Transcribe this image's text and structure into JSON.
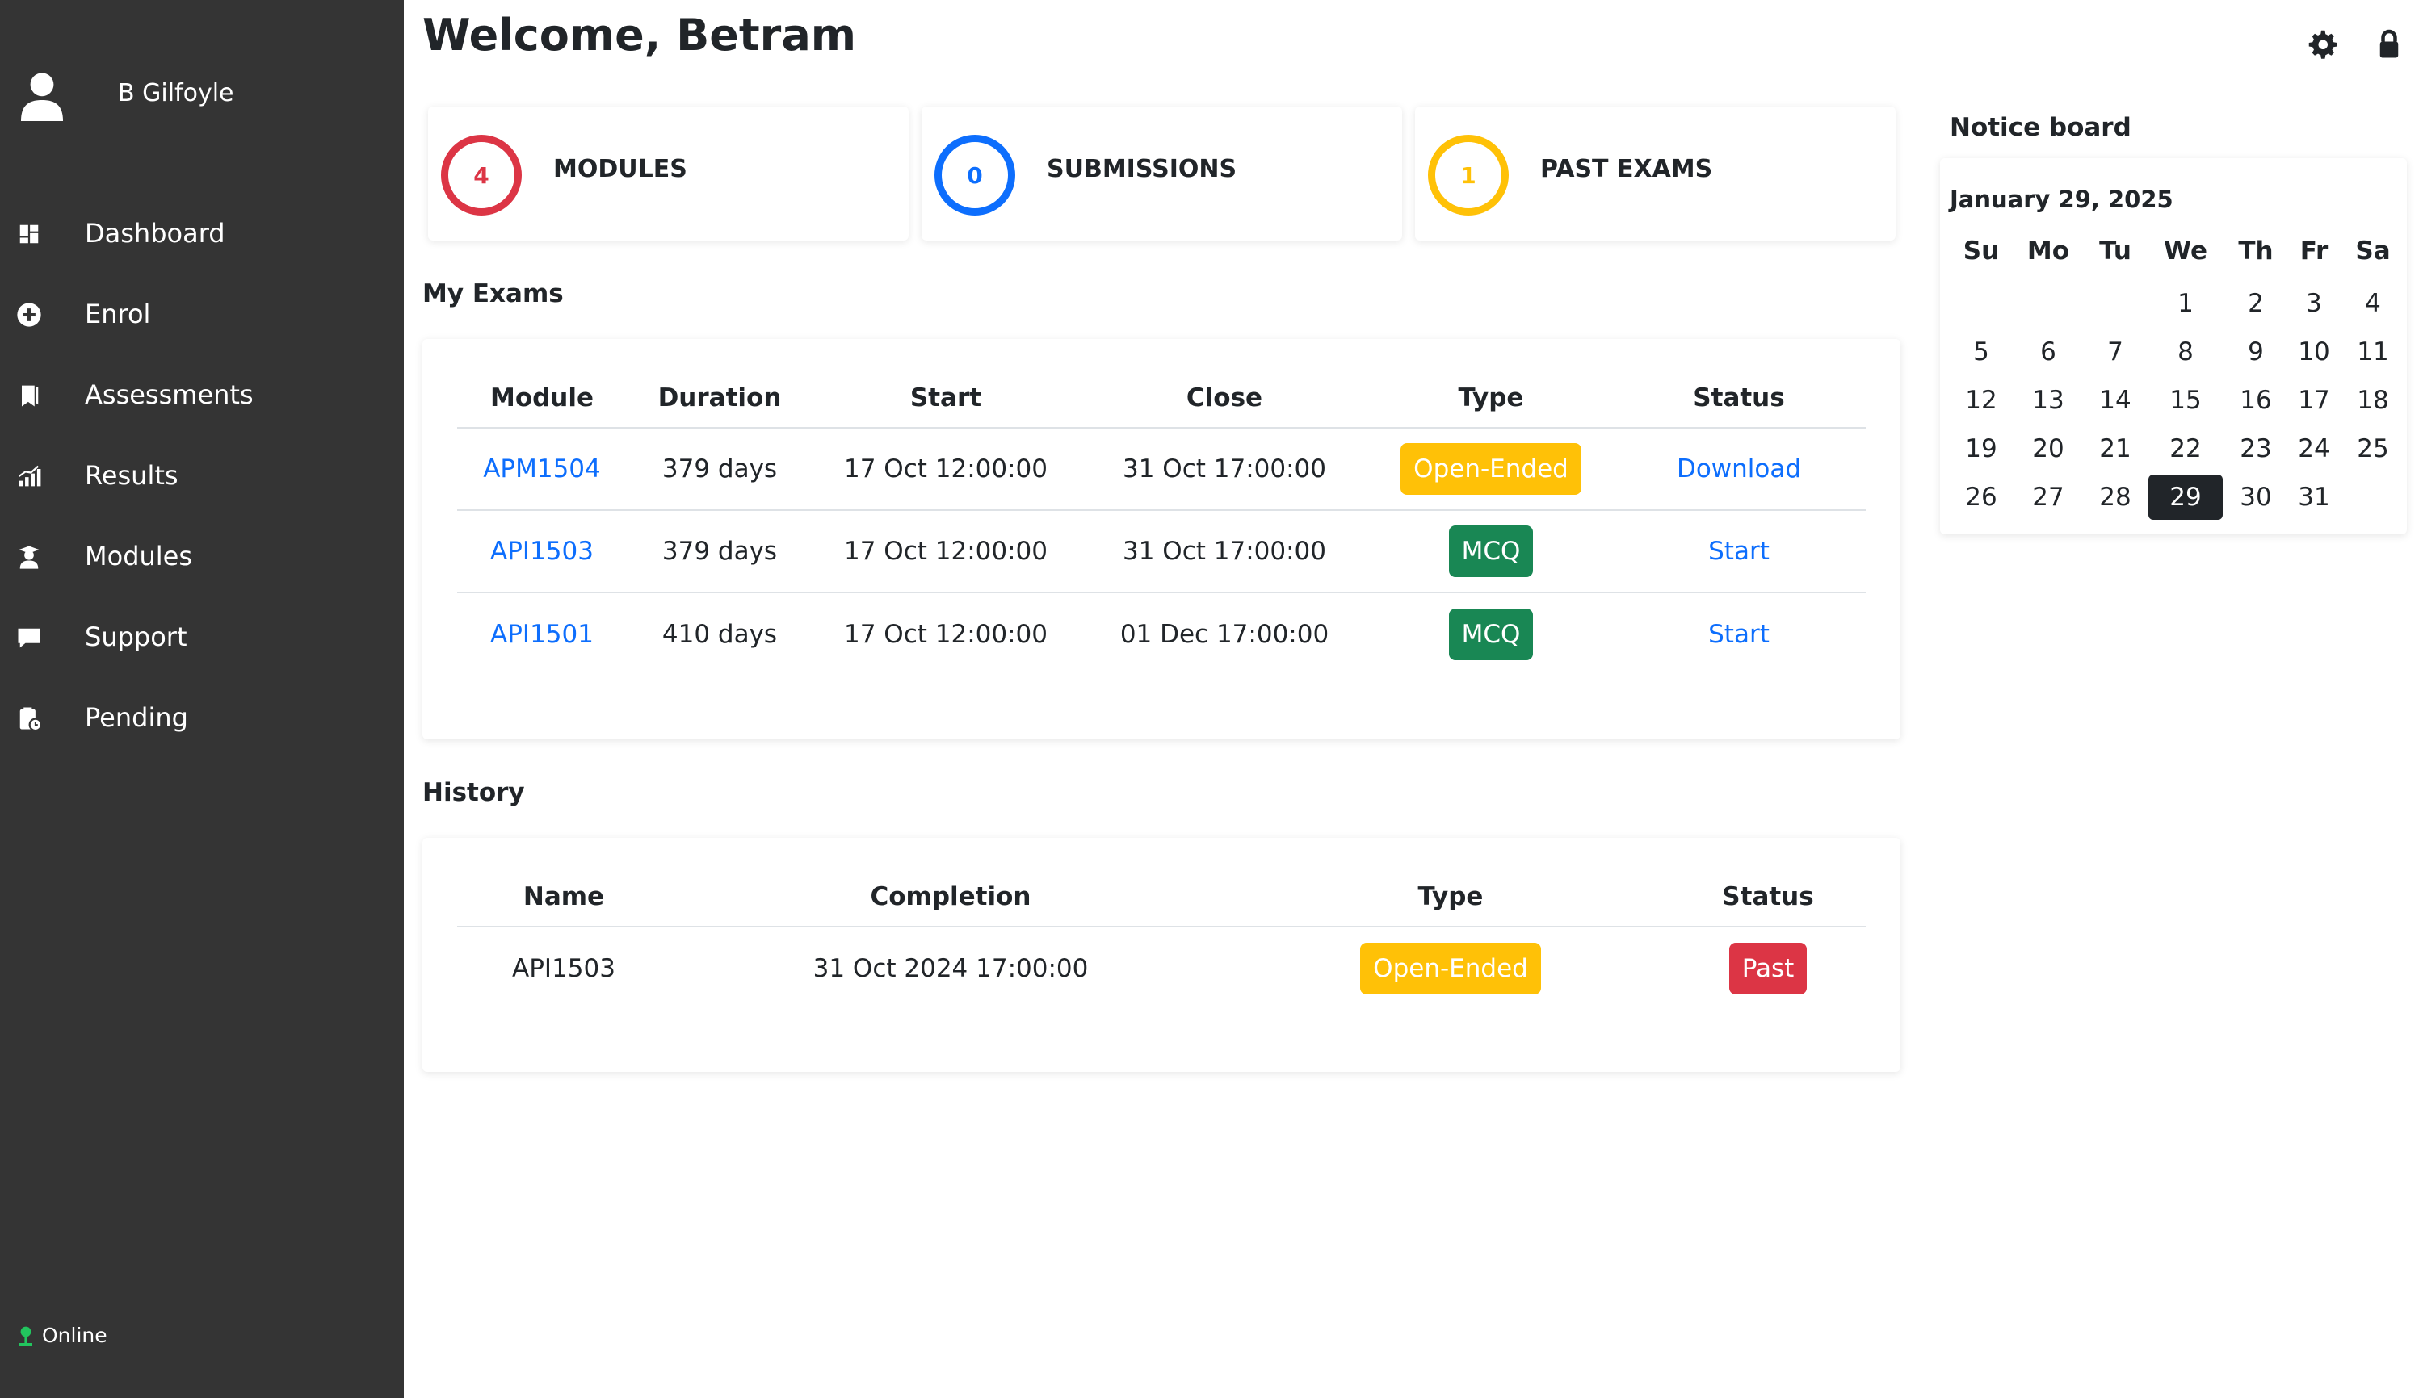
{
  "sidebar": {
    "user_name": "B Gilfoyle",
    "items": [
      {
        "label": "Dashboard",
        "icon": "dashboard-icon"
      },
      {
        "label": "Enrol",
        "icon": "plus-circle-icon"
      },
      {
        "label": "Assessments",
        "icon": "bookmarks-icon"
      },
      {
        "label": "Results",
        "icon": "bar-chart-icon"
      },
      {
        "label": "Modules",
        "icon": "student-icon"
      },
      {
        "label": "Support",
        "icon": "chat-icon"
      },
      {
        "label": "Pending",
        "icon": "clipboard-clock-icon"
      }
    ],
    "status": "Online",
    "status_color": "#22c55e"
  },
  "header": {
    "welcome": "Welcome, Betram"
  },
  "stats": [
    {
      "value": "4",
      "label": "MODULES",
      "color": "#dc3545"
    },
    {
      "value": "0",
      "label": "SUBMISSIONS",
      "color": "#0d6efd"
    },
    {
      "value": "1",
      "label": "PAST EXAMS",
      "color": "#ffc107"
    }
  ],
  "my_exams": {
    "title": "My Exams",
    "columns": [
      "Module",
      "Duration",
      "Start",
      "Close",
      "Type",
      "Status"
    ],
    "rows": [
      {
        "module": "APM1504",
        "duration": "379 days",
        "start": "17 Oct 12:00:00",
        "close": "31 Oct 17:00:00",
        "type": "Open-Ended",
        "type_style": "warning",
        "status": "Download"
      },
      {
        "module": "API1503",
        "duration": "379 days",
        "start": "17 Oct 12:00:00",
        "close": "31 Oct 17:00:00",
        "type": "MCQ",
        "type_style": "success",
        "status": "Start"
      },
      {
        "module": "API1501",
        "duration": "410 days",
        "start": "17 Oct 12:00:00",
        "close": "01 Dec 17:00:00",
        "type": "MCQ",
        "type_style": "success",
        "status": "Start"
      }
    ]
  },
  "history": {
    "title": "History",
    "columns": [
      "Name",
      "Completion",
      "Type",
      "Status"
    ],
    "rows": [
      {
        "name": "API1503",
        "completion": "31 Oct 2024 17:00:00",
        "type": "Open-Ended",
        "type_style": "warning",
        "status": "Past",
        "status_style": "danger"
      }
    ]
  },
  "notice_board": {
    "title": "Notice board",
    "date_label": "January 29, 2025",
    "weekdays": [
      "Su",
      "Mo",
      "Tu",
      "We",
      "Th",
      "Fr",
      "Sa"
    ],
    "first_weekday_index": 3,
    "days_in_month": 31,
    "today": 29
  }
}
